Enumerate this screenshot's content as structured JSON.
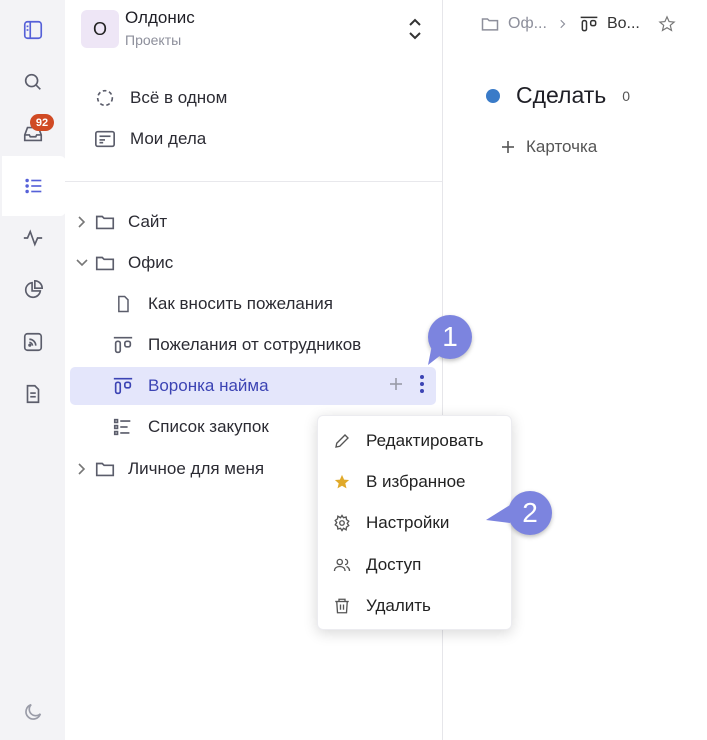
{
  "workspace": {
    "avatar_letter": "О",
    "name": "Олдонис",
    "subtitle": "Проекты"
  },
  "rail": {
    "inbox_badge": "92",
    "icons": [
      "panel-toggle-icon",
      "search-icon",
      "inbox-icon",
      "list-icon",
      "activity-icon",
      "chart-pie-icon",
      "rss-icon",
      "document-icon",
      "moon-icon"
    ]
  },
  "nav": {
    "all_in_one": "Всё в одном",
    "my_tasks": "Мои дела"
  },
  "tree": {
    "site": "Сайт",
    "office": "Офис",
    "how_to_submit": "Как вносить пожелания",
    "employee_wishes": "Пожелания от сотрудников",
    "hiring_funnel": "Воронка найма",
    "purchase_list": "Список закупок",
    "personal": "Личное для меня"
  },
  "menu": {
    "edit": "Редактировать",
    "favorite": "В избранное",
    "settings": "Настройки",
    "access": "Доступ",
    "delete": "Удалить"
  },
  "callouts": {
    "one": "1",
    "two": "2"
  },
  "breadcrumb": {
    "office": "Оф...",
    "current": "Во..."
  },
  "column": {
    "name": "Сделать",
    "count": "0",
    "status_color": "#3a7bc8",
    "add_card": "Карточка"
  },
  "colors": {
    "accent": "#5560d8",
    "selected_bg": "#e4e6fb",
    "badge": "#d04a24",
    "callout": "#7c84df",
    "star": "#e0a92a"
  }
}
